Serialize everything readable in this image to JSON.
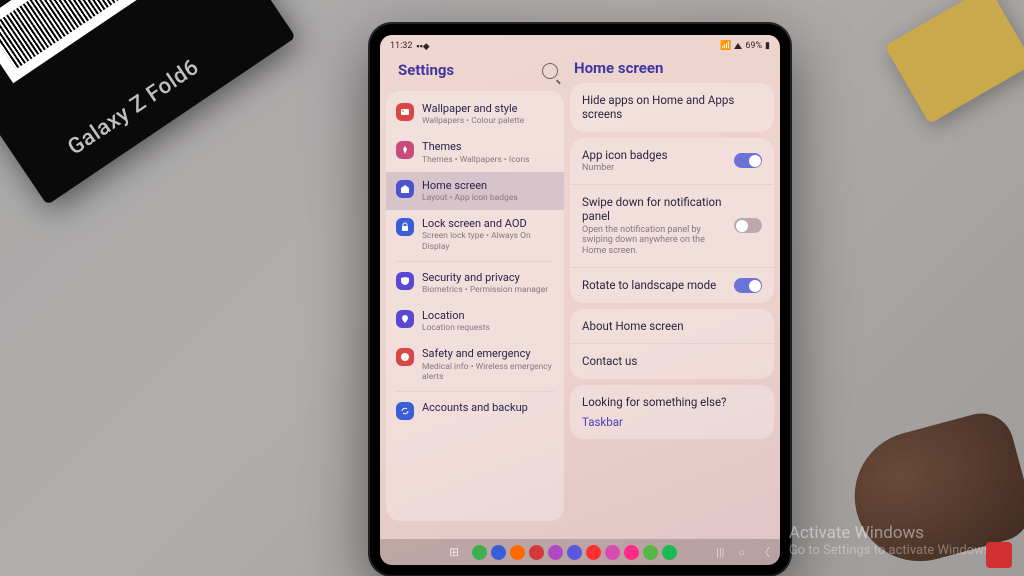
{
  "exterior": {
    "box_brand": "Galaxy Z Fold6",
    "watermark_title": "Activate Windows",
    "watermark_sub": "Go to Settings to activate Windows."
  },
  "statusbar": {
    "time": "11:32",
    "battery": "69%"
  },
  "left_panel": {
    "title": "Settings",
    "items": [
      {
        "title": "Wallpaper and style",
        "sub": "Wallpapers • Colour palette",
        "color": "#d84646",
        "icon": "img"
      },
      {
        "title": "Themes",
        "sub": "Themes • Wallpapers • Icons",
        "color": "#c94b7d",
        "icon": "theme"
      },
      {
        "title": "Home screen",
        "sub": "Layout • App icon badges",
        "color": "#4a53d0",
        "icon": "home",
        "selected": true
      },
      {
        "title": "Lock screen and AOD",
        "sub": "Screen lock type • Always On Display",
        "color": "#3a5dd8",
        "icon": "lock"
      },
      {
        "divider": true
      },
      {
        "title": "Security and privacy",
        "sub": "Biometrics • Permission manager",
        "color": "#5a48d4",
        "icon": "shield"
      },
      {
        "title": "Location",
        "sub": "Location requests",
        "color": "#5a48d4",
        "icon": "pin"
      },
      {
        "title": "Safety and emergency",
        "sub": "Medical info • Wireless emergency alerts",
        "color": "#d64848",
        "icon": "sos"
      },
      {
        "divider": true
      },
      {
        "title": "Accounts and backup",
        "sub": "",
        "color": "#3a5dd8",
        "icon": "sync"
      }
    ]
  },
  "right_panel": {
    "title": "Home screen",
    "group_top": {
      "label": "Hide apps on Home and Apps screens"
    },
    "group_mid": [
      {
        "title": "App icon badges",
        "sub": "Number",
        "toggle": "on"
      },
      {
        "title": "Swipe down for notification panel",
        "sub": "Open the notification panel by swiping down anywhere on the Home screen.",
        "toggle": "off"
      },
      {
        "title": "Rotate to landscape mode",
        "sub": "",
        "toggle": "on"
      }
    ],
    "group_about": [
      {
        "title": "About Home screen"
      },
      {
        "title": "Contact us"
      }
    ],
    "group_else": {
      "prompt": "Looking for something else?",
      "link": "Taskbar"
    }
  },
  "dock_colors": [
    "#3fae4f",
    "#3a5dd8",
    "#ff6a00",
    "#d23a3a",
    "#b048c4",
    "#5858e0",
    "#ff3030",
    "#d84bb0",
    "#ff2a8a",
    "#56b648",
    "#1db954"
  ]
}
